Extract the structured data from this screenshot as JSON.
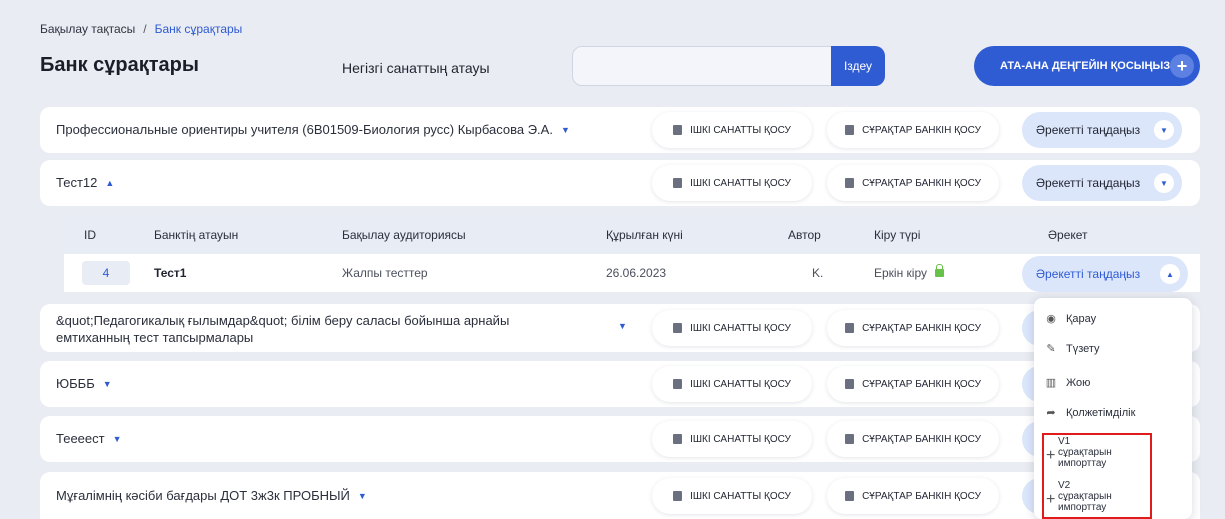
{
  "breadcrumb": {
    "home": "Бақылау тақтасы",
    "separator": "/",
    "current": "Банк сұрақтары"
  },
  "page_title": "Банк сұрақтары",
  "parent_category_label": "Негізгі санаттың атауы",
  "search": {
    "value": "",
    "button": "Іздеу"
  },
  "add_parent_button": "АТА-АНА ДЕҢГЕЙІН ҚОСЫҢЫЗ",
  "add_sub_label": "ІШКІ САНАТТЫ ҚОСУ",
  "add_bank_label": "СҰРАҚТАР БАНКІН ҚОСУ",
  "select_action_label": "Әрекетті таңдаңыз",
  "rows": [
    {
      "title": "Профессиональные ориентиры учителя (6В01509-Биология русс) Кырбасова Э.А."
    },
    {
      "title": "Тест12"
    },
    {
      "title_line1": "&quot;Педагогикалық ғылымдар&quot; білім беру саласы бойынша арнайы",
      "title_line2": "емтиханның тест тапсырмалары"
    },
    {
      "title": "ЮБББ"
    },
    {
      "title": "Теееест"
    },
    {
      "title": "Мұғалімнің кәсіби бағдары ДОТ 3ж3к ПРОБНЫЙ"
    }
  ],
  "table": {
    "headers": [
      "ID",
      "Банктің атауын",
      "Бақылау аудиториясы",
      "Құрылған күні",
      "Автор",
      "Кіру түрі",
      "Әрекет"
    ],
    "row": {
      "id": "4",
      "name": "Тест1",
      "audience": "Жалпы тесттер",
      "created": "26.06.2023",
      "author": "K.",
      "access": "Еркін кіру"
    }
  },
  "dropdown": {
    "view": "Қарау",
    "edit": "Түзету",
    "delete": "Жою",
    "access": "Қолжетімділік",
    "import_v1": [
      "V1",
      "сұрақтарын",
      "импорттау"
    ],
    "import_v2": [
      "V2",
      "сұрақтарын",
      "импорттау"
    ]
  },
  "colors": {
    "primary": "#2f5bd3",
    "action_pill": "#dce6fb",
    "highlight": "#e01b1b",
    "lock": "#68c14a"
  },
  "icons": [
    "document-icon",
    "eye-icon",
    "pencil-icon",
    "trash-icon",
    "share-icon",
    "plus-icon",
    "lock-icon",
    "chevron-down-icon",
    "chevron-up-icon"
  ]
}
